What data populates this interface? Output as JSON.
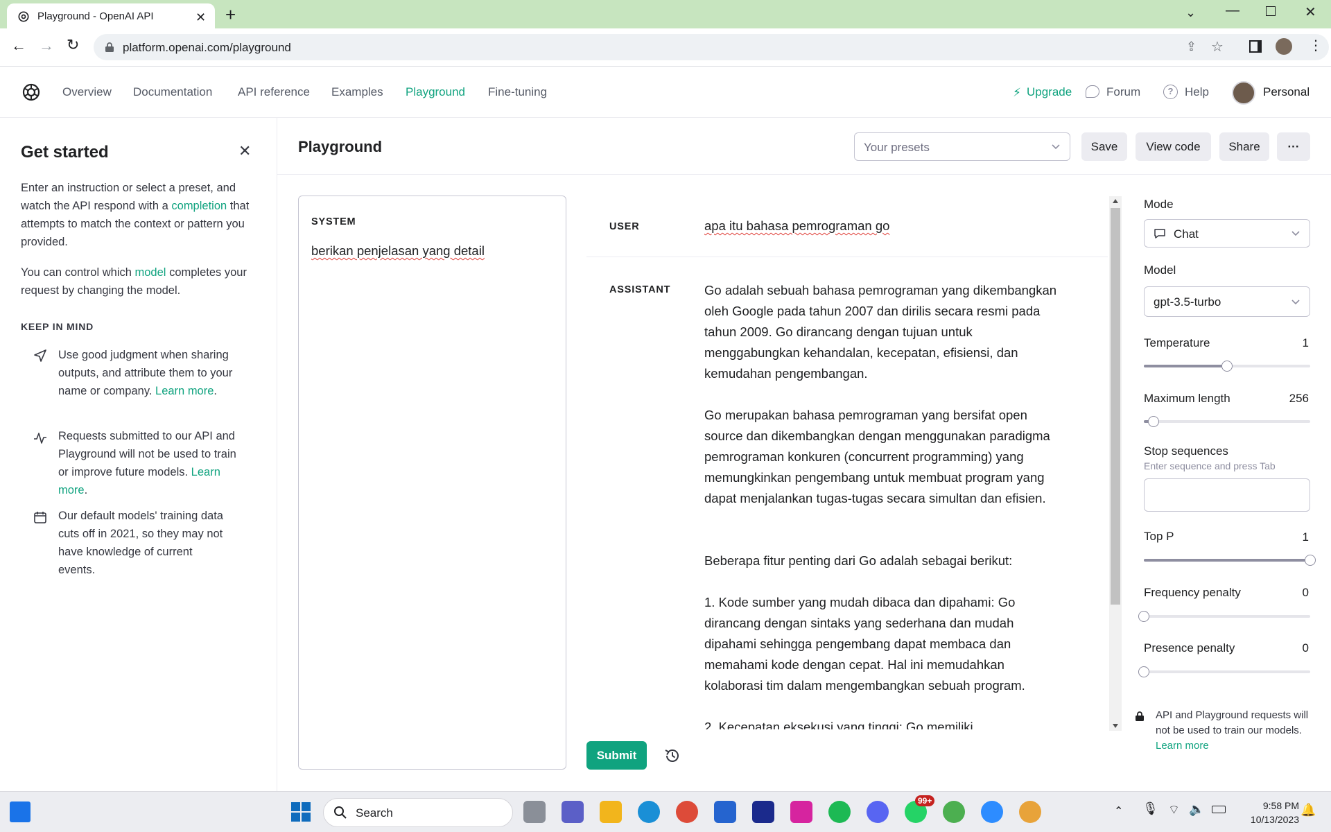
{
  "browser": {
    "tab_title": "Playground - OpenAI API",
    "url": "platform.openai.com/playground"
  },
  "nav": {
    "links": [
      "Overview",
      "Documentation",
      "API reference",
      "Examples",
      "Playground",
      "Fine-tuning"
    ],
    "active": "Playground",
    "upgrade": "Upgrade",
    "forum": "Forum",
    "help": "Help",
    "account": "Personal"
  },
  "left_panel": {
    "title": "Get started",
    "intro_1": "Enter an instruction or select a preset, and watch the API respond with a",
    "intro_link": "completion",
    "intro_2": "that attempts to match the context or pattern you provided.",
    "model_1": "You can control which",
    "model_link": "model",
    "model_2": "completes your request by changing the model.",
    "keep_in_mind": "KEEP IN MIND",
    "tips": [
      {
        "text": "Use good judgment when sharing outputs, and attribute them to your name or company.",
        "link": "Learn more",
        "icon": "send-icon"
      },
      {
        "text": "Requests submitted to our API and Playground will not be used to train or improve future models.",
        "link": "Learn more",
        "icon": "activity-icon"
      },
      {
        "text": "Our default models' training data cuts off in 2021, so they may not have knowledge of current events.",
        "link": "",
        "icon": "calendar-icon"
      }
    ]
  },
  "main": {
    "title": "Playground",
    "presets_placeholder": "Your presets",
    "save": "Save",
    "view_code": "View code",
    "share": "Share",
    "more": "···",
    "system_label": "SYSTEM",
    "system_text": "berikan penjelasan yang detail",
    "user_label": "USER",
    "user_text": "apa itu bahasa pemrograman go",
    "assistant_label": "ASSISTANT",
    "assistant_paragraphs": [
      "Go adalah sebuah bahasa pemrograman yang dikembangkan oleh Google pada tahun 2007 dan dirilis secara resmi pada tahun 2009. Go dirancang dengan tujuan untuk menggabungkan kehandalan, kecepatan, efisiensi, dan kemudahan pengembangan.",
      "Go merupakan bahasa pemrograman yang bersifat open source dan dikembangkan dengan menggunakan paradigma pemrograman konkuren (concurrent programming) yang memungkinkan pengembang untuk membuat program yang dapat menjalankan tugas-tugas secara simultan dan efisien.",
      "Beberapa fitur penting dari Go adalah sebagai berikut:",
      "1. Kode sumber yang mudah dibaca dan dipahami: Go dirancang dengan sintaks yang sederhana dan mudah dipahami sehingga pengembang dapat membaca dan memahami kode dengan cepat. Hal ini memudahkan kolaborasi tim dalam mengembangkan sebuah program.",
      "2. Kecepatan eksekusi yang tinggi: Go memiliki"
    ],
    "submit": "Submit"
  },
  "settings": {
    "mode_label": "Mode",
    "mode_value": "Chat",
    "model_label": "Model",
    "model_value": "gpt-3.5-turbo",
    "temperature_label": "Temperature",
    "temperature_value": "1",
    "temperature_level": 0.5,
    "max_length_label": "Maximum length",
    "max_length_value": "256",
    "max_length_level": 0.06,
    "stop_label": "Stop sequences",
    "stop_hint": "Enter sequence and press Tab",
    "top_p_label": "Top P",
    "top_p_value": "1",
    "top_p_level": 1.0,
    "freq_label": "Frequency penalty",
    "freq_value": "0",
    "freq_level": 0.0,
    "presence_label": "Presence penalty",
    "presence_value": "0",
    "presence_level": 0.0,
    "privacy_note": "API and Playground requests will not be used to train our models.",
    "privacy_link": "Learn more"
  },
  "taskbar": {
    "search_placeholder": "Search",
    "badge": "99+",
    "time": "9:58 PM",
    "date": "10/13/2023"
  },
  "colors": {
    "accent": "#10a37f",
    "tabbar": "#c7e5bf"
  }
}
